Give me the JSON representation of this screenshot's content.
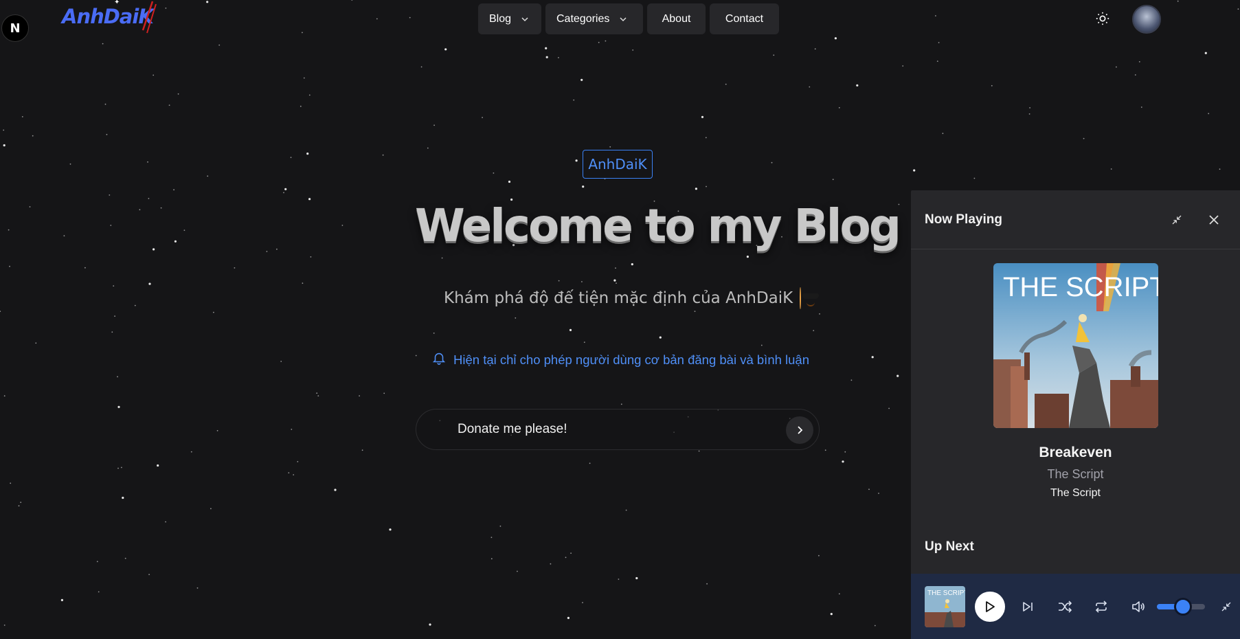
{
  "logo": {
    "text": "AnhDaiK",
    "color": "#4a6cf5"
  },
  "next_badge": "N",
  "nav": {
    "blog": "Blog",
    "categories": "Categories",
    "about": "About",
    "contact": "Contact"
  },
  "hero": {
    "tag": "AnhDaiK",
    "title": "Welcome to my Blog",
    "subtitle": "Khám phá độ đế tiện mặc định của AnhDaiK",
    "notice": "Hiện tại chỉ cho phép người dùng cơ bản đăng bài và bình luận",
    "donate": "Donate me please!"
  },
  "player": {
    "header": "Now Playing",
    "track": {
      "title": "Breakeven",
      "artist": "The Script",
      "album": "The Script"
    },
    "up_next": "Up Next",
    "cover_text": "THE SCRIPT",
    "volume": 0.55
  },
  "colors": {
    "accent": "#3b82f6",
    "background": "#151517",
    "panel": "#27272a",
    "controls_bar": "#1f2a44"
  },
  "icons": [
    "next-logo-icon",
    "chevron-down-icon",
    "sun-icon",
    "bell-icon",
    "chevron-right-icon",
    "minimize-icon",
    "close-icon",
    "play-icon",
    "skip-next-icon",
    "shuffle-icon",
    "repeat-icon",
    "volume-icon"
  ]
}
